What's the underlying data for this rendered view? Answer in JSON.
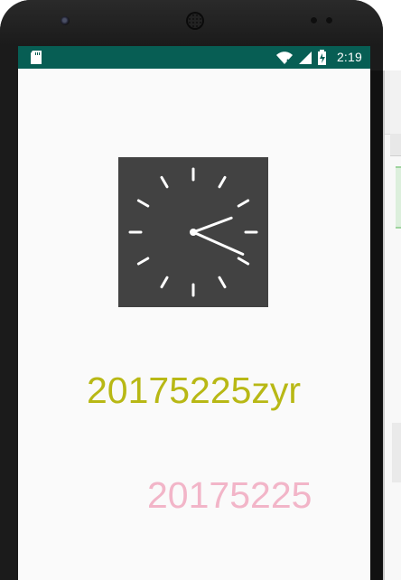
{
  "status_bar": {
    "time": "2:19",
    "left_icon": "sd-card-icon",
    "icons": [
      "wifi-icon",
      "signal-icon",
      "battery-icon"
    ],
    "color": "#075e54"
  },
  "clock": {
    "hour": 2,
    "minute": 19,
    "background": "#424242",
    "hand_color": "#ffffff"
  },
  "texts": {
    "primary": "20175225zyr",
    "secondary": "20175225"
  },
  "colors": {
    "primary_text": "#b8b815",
    "secondary_text": "#f2b5c8",
    "screen_background": "#fafafa",
    "device_frame": "#1b1b1b"
  }
}
